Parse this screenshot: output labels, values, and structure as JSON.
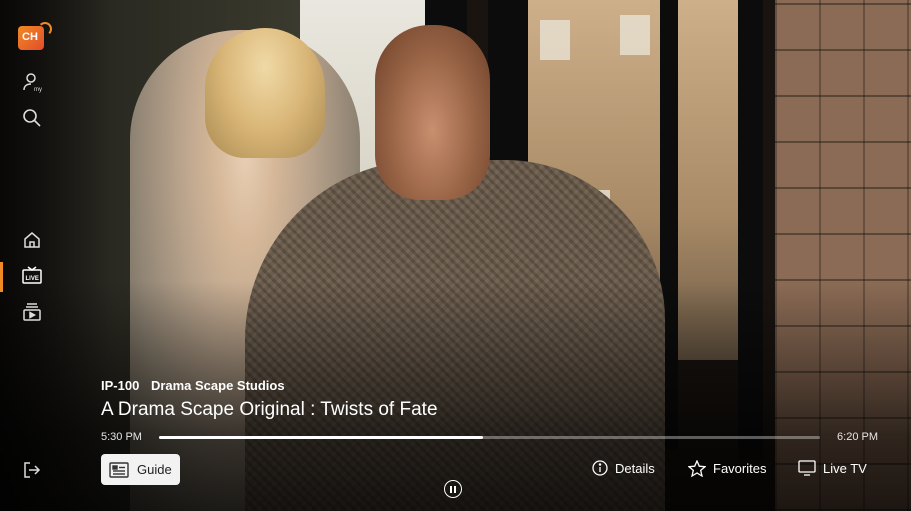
{
  "app": {
    "logo_text": "CH",
    "accent_color": "#f08a24"
  },
  "sidebar": {
    "items": [
      {
        "icon": "profile-icon",
        "label": "my"
      },
      {
        "icon": "search-icon"
      },
      {
        "icon": "home-icon"
      },
      {
        "icon": "live-tv-icon",
        "label": "LIVE",
        "active": true
      },
      {
        "icon": "library-icon"
      },
      {
        "icon": "exit-icon"
      }
    ]
  },
  "program": {
    "channel_number": "IP-100",
    "channel_name": "Drama Scape Studios",
    "title": "A Drama Scape Original : Twists of Fate",
    "start_time": "5:30 PM",
    "end_time": "6:20 PM",
    "progress": 0.49
  },
  "controls": {
    "guide_label": "Guide",
    "details_label": "Details",
    "favorites_label": "Favorites",
    "live_tv_label": "Live TV"
  }
}
